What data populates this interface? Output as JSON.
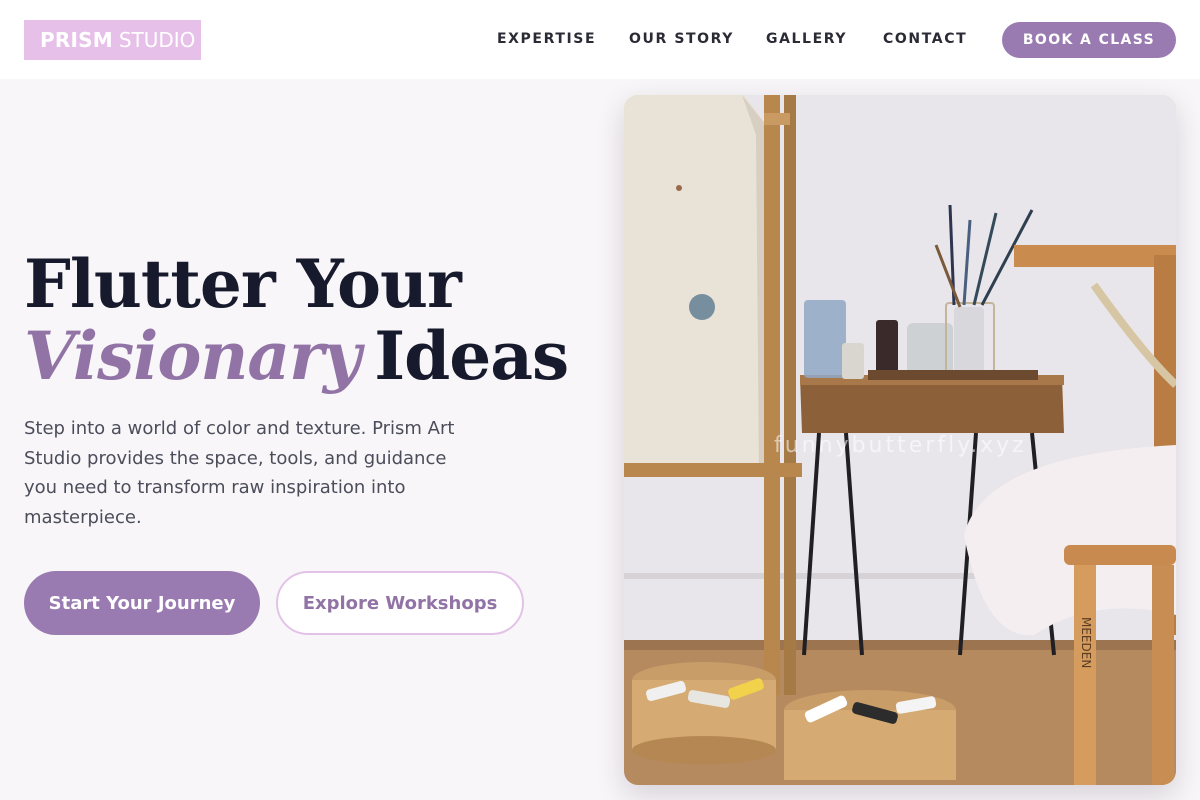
{
  "brand": {
    "name": "PRISM",
    "suffix": "STUDIO"
  },
  "nav": {
    "items": [
      "EXPERTISE",
      "OUR STORY",
      "GALLERY",
      "CONTACT"
    ],
    "cta_label": "BOOK A CLASS"
  },
  "hero": {
    "headline_line1": "Flutter Your",
    "headline_accent": "Visionary",
    "headline_rest": "Ideas",
    "lead": "Step into a world of color and texture. Prism Art Studio provides the space, tools, and guidance you need to transform raw inspiration into masterpiece.",
    "primary_button": "Start Your Journey",
    "secondary_button": "Explore Workshops"
  },
  "image": {
    "alt": "Art studio corner with brushes, paint jars and baskets of paint tubes",
    "watermark": "funnybutterfly.xyz",
    "stool_text": "MEEDEN"
  },
  "colors": {
    "accent": "#9a7bb1",
    "accent_light": "#e7c0e9",
    "heading": "#171a2c",
    "background": "#f8f6f8"
  }
}
